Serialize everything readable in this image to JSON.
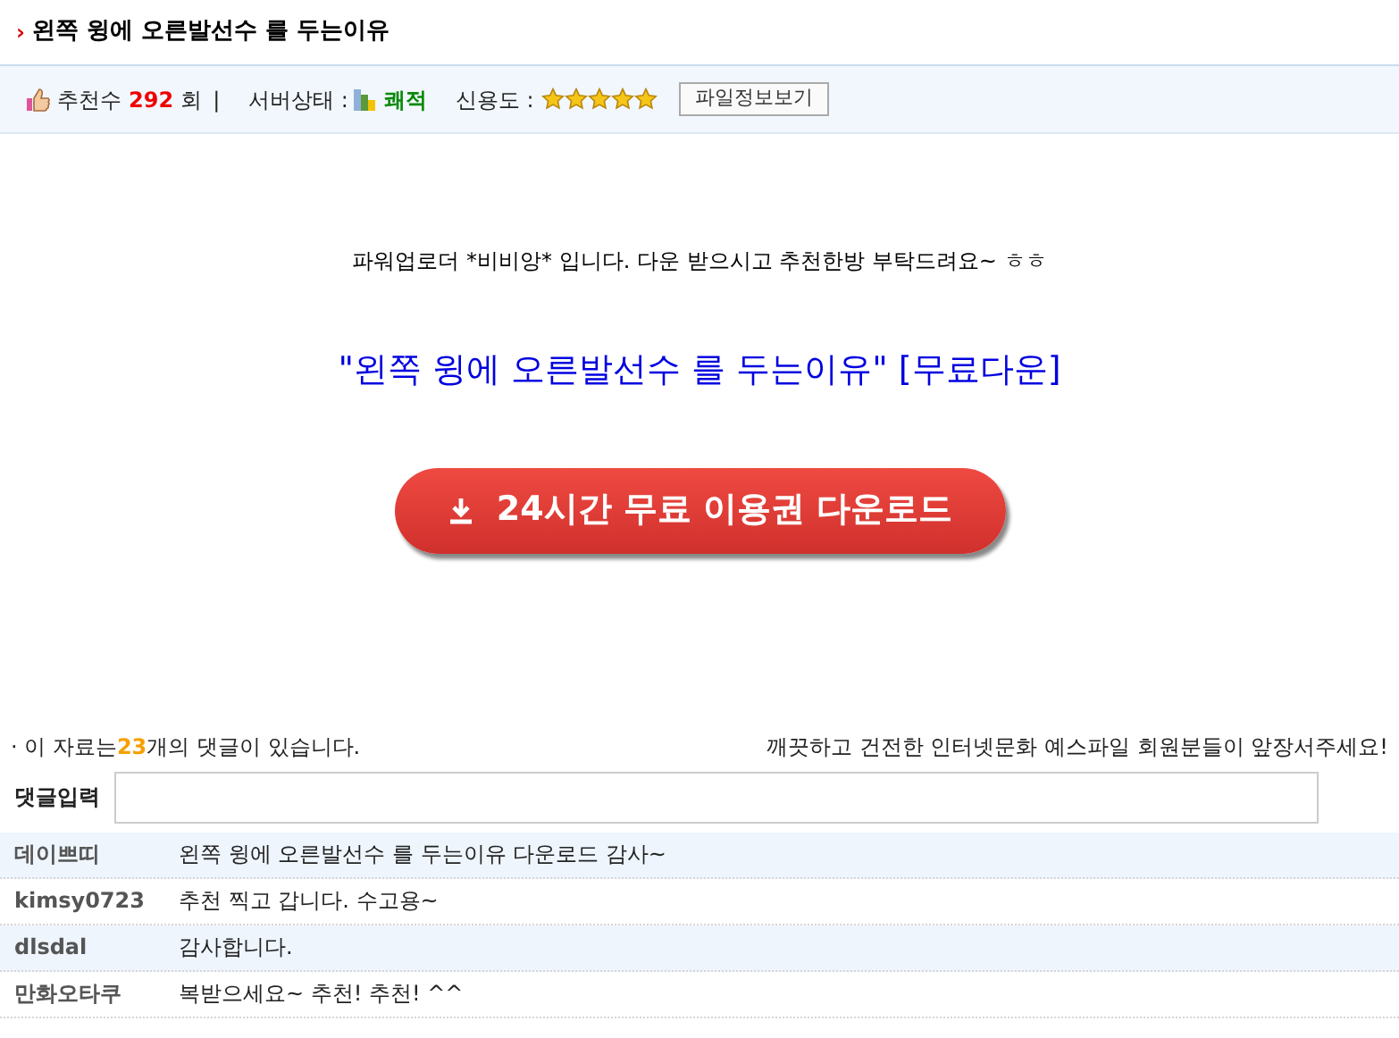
{
  "title": {
    "marker": "›",
    "text": "왼쪽 윙에 오른발선수 를 두는이유"
  },
  "info": {
    "recommend_label": "추천수",
    "recommend_count": "292",
    "recommend_unit": "회",
    "separator": "|",
    "server_label": "서버상태 :",
    "server_status": "쾌적",
    "trust_label": "신용도 :",
    "stars": 5,
    "button": "파일정보보기"
  },
  "body": {
    "intro": "파워업로더 *비비앙* 입니다. 다운 받으시고 추천한방 부탁드려요~ ㅎㅎ",
    "headline": "\"왼쪽 윙에 오른발선수 를 두는이유\" [무료다운]",
    "download_button": "24시간 무료 이용권 다운로드"
  },
  "comments": {
    "count_prefix": "· 이 자료는",
    "count": "23",
    "count_suffix": "개의 댓글이 있습니다.",
    "notice": "깨끗하고 건전한 인터넷문화 예스파일 회원분들이 앞장서주세요!",
    "input_label": "댓글입력",
    "items": [
      {
        "author": "데이쁘띠",
        "text": "왼쪽 윙에 오른발선수 를 두는이유 다운로드 감사~"
      },
      {
        "author": "kimsy0723",
        "text": "추천 찍고 갑니다. 수고용~"
      },
      {
        "author": "dlsdal",
        "text": "감사합니다."
      },
      {
        "author": "만화오타쿠",
        "text": "복받으세요~ 추천! 추천! ^^"
      }
    ]
  }
}
